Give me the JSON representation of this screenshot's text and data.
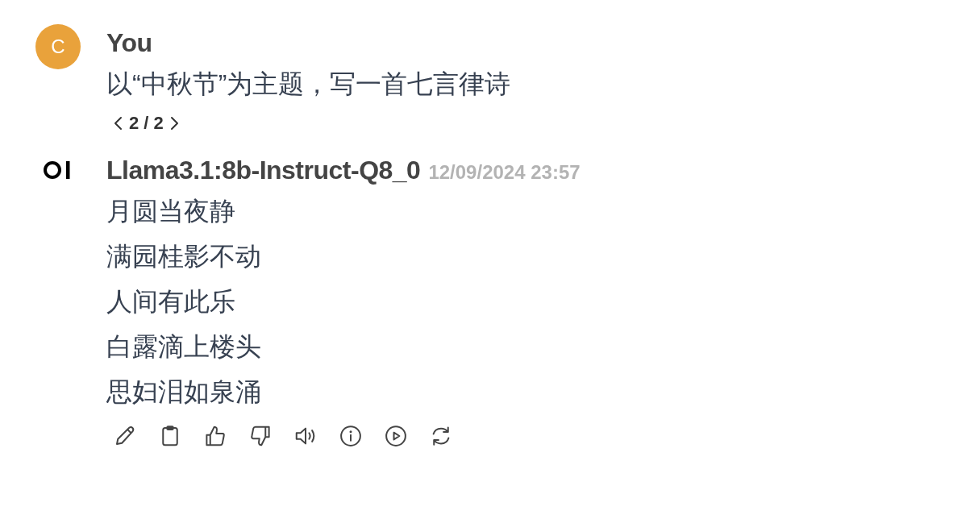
{
  "user_message": {
    "avatar_letter": "C",
    "name": "You",
    "text": "以“中秋节”为主题，写一首七言律诗",
    "pager": "2 / 2"
  },
  "assistant_message": {
    "model": "Llama3.1:8b-Instruct-Q8_0",
    "timestamp": "12/09/2024 23:57",
    "lines": [
      "月圆当夜静",
      "满园桂影不动",
      "人间有此乐",
      "白露滴上楼头",
      "思妇泪如泉涌"
    ]
  }
}
